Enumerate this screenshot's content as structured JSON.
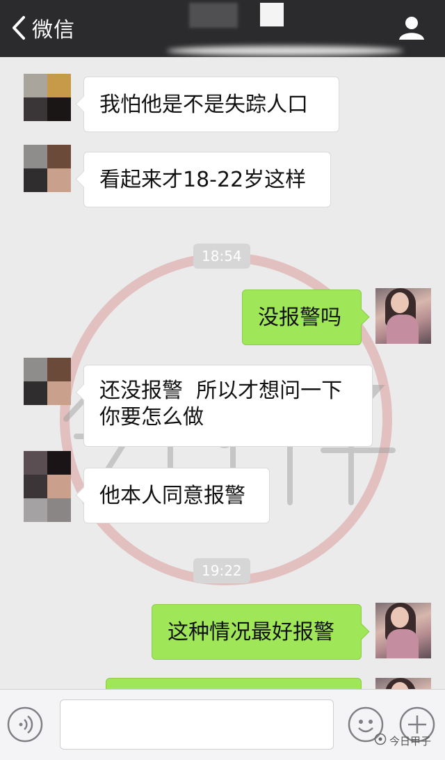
{
  "header": {
    "back_label": "微信",
    "icons": {
      "back": "chevron-left-icon",
      "profile": "person-icon"
    }
  },
  "colors": {
    "header_bg": "#2b2b2d",
    "chat_bg": "#ebebeb",
    "bubble_left": "#ffffff",
    "bubble_right": "#9fe658",
    "watermark": "#d98c8c"
  },
  "messages": [
    {
      "side": "left",
      "text": "我怕他是不是失踪人口"
    },
    {
      "side": "left",
      "text": "看起来才18-22岁这样"
    },
    {
      "type": "time",
      "text": "18:54"
    },
    {
      "side": "right",
      "text": "没报警吗"
    },
    {
      "side": "left",
      "line1": "还没报警  所以才想问一下",
      "line2": "你要怎么做"
    },
    {
      "side": "left",
      "text": "他本人同意报警"
    },
    {
      "type": "time",
      "text": "19:22"
    },
    {
      "side": "right",
      "text": "这种情况最好报警"
    },
    {
      "side": "right",
      "text": ""
    }
  ],
  "watermark": {
    "text": "今日甲子"
  },
  "inputbar": {
    "icons": {
      "voice": "voice-icon",
      "emoji": "emoji-icon",
      "plus": "plus-icon"
    },
    "source_label": "今日甲子"
  }
}
